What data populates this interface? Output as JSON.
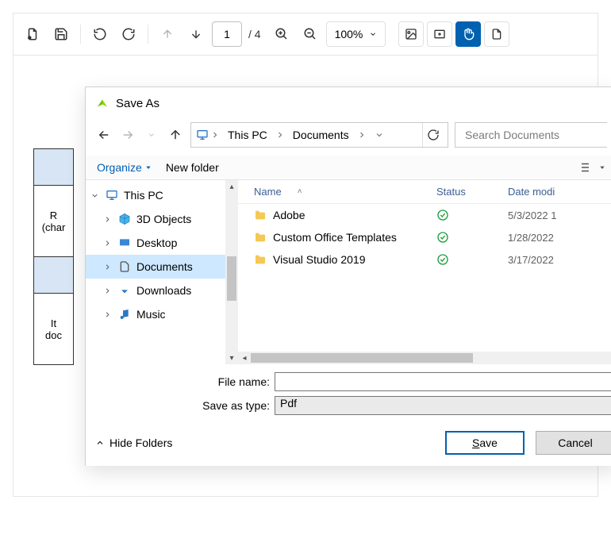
{
  "toolbar": {
    "page_current": "1",
    "page_total": "/ 4",
    "zoom_value": "100%"
  },
  "sheet": {
    "row_head": "R",
    "row_sub": "(char",
    "it_head": "It",
    "it_sub": "doc"
  },
  "dialog": {
    "title": "Save As",
    "breadcrumb": [
      "This PC",
      "Documents"
    ],
    "search_placeholder": "Search Documents",
    "organize_label": "Organize",
    "new_folder_label": "New folder",
    "tree": {
      "root": "This PC",
      "items": [
        {
          "label": "3D Objects"
        },
        {
          "label": "Desktop"
        },
        {
          "label": "Documents"
        },
        {
          "label": "Downloads"
        },
        {
          "label": "Music"
        }
      ]
    },
    "columns": {
      "name": "Name",
      "status": "Status",
      "date": "Date modi"
    },
    "files": [
      {
        "name": "Adobe",
        "date": "5/3/2022 1"
      },
      {
        "name": "Custom Office Templates",
        "date": "1/28/2022"
      },
      {
        "name": "Visual Studio 2019",
        "date": "3/17/2022"
      }
    ],
    "file_name_label": "File name:",
    "file_name_value": "",
    "save_type_label": "Save as type:",
    "save_type_value": "Pdf",
    "hide_folders_label": "Hide Folders",
    "save_label_prefix": "S",
    "save_label_suffix": "ave",
    "cancel_label": "Cancel"
  }
}
